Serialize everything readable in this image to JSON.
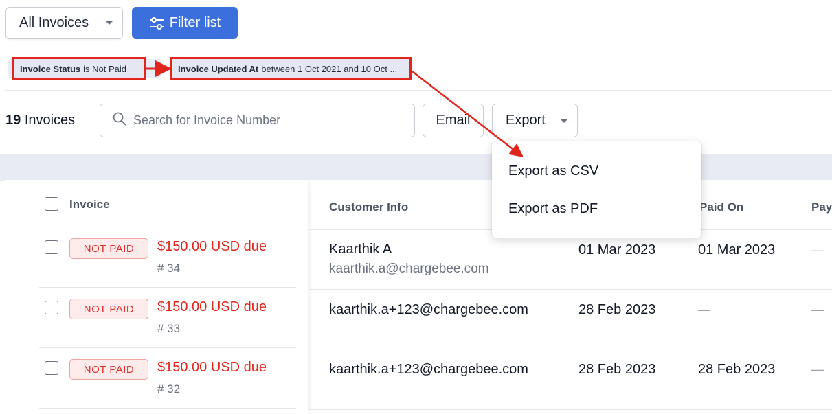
{
  "toolbar": {
    "view_select": "All Invoices",
    "filter_label": "Filter list"
  },
  "filters": [
    {
      "field": "Invoice Status",
      "condition": "is Not Paid"
    },
    {
      "field": "Invoice Updated At",
      "condition": "between 1 Oct 2021 and 10 Oct ..."
    }
  ],
  "list": {
    "count": "19",
    "count_label": "Invoices",
    "search_placeholder": "Search for Invoice Number",
    "email_label": "Email",
    "export_label": "Export"
  },
  "export_menu": [
    "Export as CSV",
    "Export as PDF"
  ],
  "table": {
    "columns": [
      "Invoice",
      "Customer Info",
      "Paid On",
      "Pay"
    ],
    "rows": [
      {
        "status": "NOT PAID",
        "due": "$150.00 USD due",
        "number": "# 34",
        "customer_name": "Kaarthik A",
        "customer_email": "kaarthik.a@chargebee.com",
        "date": "01 Mar 2023",
        "paid_on": "01 Mar 2023",
        "pay": "—"
      },
      {
        "status": "NOT PAID",
        "due": "$150.00 USD due",
        "number": "# 33",
        "customer_name": "kaarthik.a+123@chargebee.com",
        "customer_email": "",
        "date": "28 Feb 2023",
        "paid_on": "—",
        "pay": "—"
      },
      {
        "status": "NOT PAID",
        "due": "$150.00 USD due",
        "number": "# 32",
        "customer_name": "kaarthik.a+123@chargebee.com",
        "customer_email": "",
        "date": "28 Feb 2023",
        "paid_on": "28 Feb 2023",
        "pay": "—"
      }
    ]
  },
  "colors": {
    "primary": "#3b6fdb",
    "due_red": "#e0261c",
    "annotation_red": "#e0261c",
    "badge_bg": "#fdeaea"
  },
  "icons": {
    "filter": "sliders-icon",
    "search": "search-icon",
    "caret": "chevron-down-icon"
  }
}
